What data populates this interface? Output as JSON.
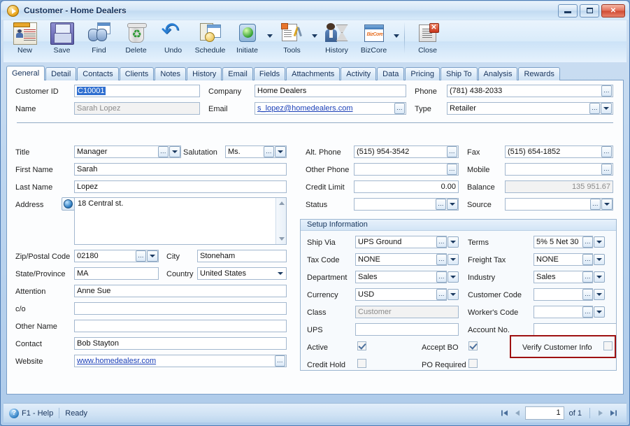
{
  "window": {
    "title": "Customer - Home Dealers",
    "app_icon": "play-circle-icon",
    "buttons": {
      "minimize": "minimize-icon",
      "maximize": "maximize-icon",
      "close": "close-icon"
    }
  },
  "toolbar": {
    "items": [
      {
        "label": "New",
        "icon": "new-record-icon",
        "dropdown": false
      },
      {
        "label": "Save",
        "icon": "save-floppy-icon",
        "dropdown": false
      },
      {
        "label": "Find",
        "icon": "find-binoculars-icon",
        "dropdown": false
      },
      {
        "label": "Delete",
        "icon": "delete-recycle-bin-icon",
        "dropdown": false
      },
      {
        "label": "Undo",
        "icon": "undo-arrow-icon",
        "dropdown": false
      },
      {
        "label": "Schedule",
        "icon": "schedule-clock-icon",
        "dropdown": false
      },
      {
        "label": "Initiate",
        "icon": "initiate-traffic-light-icon",
        "dropdown": true
      },
      {
        "label": "Tools",
        "icon": "tools-wrench-icon",
        "dropdown": true
      },
      {
        "label": "History",
        "icon": "history-person-hourglass-icon",
        "dropdown": false
      },
      {
        "label": "BizCore",
        "icon": "bizcore-window-icon",
        "dropdown": true
      },
      {
        "label": "Close",
        "icon": "close-document-icon",
        "dropdown": false
      }
    ],
    "bizcore_badge": "BizCore"
  },
  "tabs": {
    "active": "General",
    "items": [
      "General",
      "Detail",
      "Contacts",
      "Clients",
      "Notes",
      "History",
      "Email",
      "Fields",
      "Attachments",
      "Activity",
      "Data",
      "Pricing",
      "Ship To",
      "Analysis",
      "Rewards"
    ]
  },
  "header_fields": {
    "customer_id": {
      "label": "Customer ID",
      "value": "C10001",
      "selected": true
    },
    "name": {
      "label": "Name",
      "value": "Sarah Lopez",
      "readonly": true
    },
    "company": {
      "label": "Company",
      "value": "Home Dealers"
    },
    "email": {
      "label": "Email",
      "value": "s_lopez@homedealers.com",
      "link": true
    },
    "phone": {
      "label": "Phone",
      "value": "(781) 438-2033"
    },
    "type": {
      "label": "Type",
      "value": "Retailer"
    }
  },
  "left_column": {
    "title": {
      "label": "Title",
      "value": "Manager"
    },
    "salutation": {
      "label": "Salutation",
      "value": "Ms."
    },
    "first_name": {
      "label": "First Name",
      "value": "Sarah"
    },
    "last_name": {
      "label": "Last Name",
      "value": "Lopez"
    },
    "address": {
      "label": "Address",
      "value": "18 Central st.",
      "globe_icon": "globe-icon"
    },
    "zip": {
      "label": "Zip/Postal Code",
      "value": "02180"
    },
    "city": {
      "label": "City",
      "value": "Stoneham"
    },
    "state": {
      "label": "State/Province",
      "value": "MA"
    },
    "country": {
      "label": "Country",
      "value": "United States"
    },
    "attention": {
      "label": "Attention",
      "value": "Anne Sue"
    },
    "co": {
      "label": "c/o",
      "value": ""
    },
    "other_name": {
      "label": "Other Name",
      "value": ""
    },
    "contact": {
      "label": "Contact",
      "value": "Bob Stayton"
    },
    "website": {
      "label": "Website",
      "value": "www.homedealesr.com",
      "link": true
    }
  },
  "right_column": {
    "alt_phone": {
      "label": "Alt. Phone",
      "value": "(515) 954-3542"
    },
    "fax": {
      "label": "Fax",
      "value": "(515) 654-1852"
    },
    "other_phone": {
      "label": "Other Phone",
      "value": ""
    },
    "mobile": {
      "label": "Mobile",
      "value": ""
    },
    "credit_limit": {
      "label": "Credit Limit",
      "value": "0.00"
    },
    "balance": {
      "label": "Balance",
      "value": "135 951.67",
      "readonly": true
    },
    "status": {
      "label": "Status",
      "value": ""
    },
    "source": {
      "label": "Source",
      "value": ""
    }
  },
  "setup_information": {
    "title": "Setup Information",
    "ship_via": {
      "label": "Ship Via",
      "value": "UPS Ground"
    },
    "terms": {
      "label": "Terms",
      "value": "5% 5 Net 30"
    },
    "tax_code": {
      "label": "Tax Code",
      "value": "NONE"
    },
    "freight_tax": {
      "label": "Freight Tax",
      "value": "NONE"
    },
    "department": {
      "label": "Department",
      "value": "Sales"
    },
    "industry": {
      "label": "Industry",
      "value": "Sales"
    },
    "currency": {
      "label": "Currency",
      "value": "USD"
    },
    "customer_code": {
      "label": "Customer Code",
      "value": ""
    },
    "class": {
      "label": "Class",
      "value": "Customer",
      "readonly": true
    },
    "workers_code": {
      "label": "Worker's Code",
      "value": ""
    },
    "ups": {
      "label": "UPS",
      "value": ""
    },
    "account_no": {
      "label": "Account No.",
      "value": ""
    },
    "checkboxes": {
      "active": {
        "label": "Active",
        "checked": true
      },
      "accept_bo": {
        "label": "Accept BO",
        "checked": true
      },
      "verify_info": {
        "label": "Verify Customer Info",
        "checked": false,
        "highlighted": true
      },
      "credit_hold": {
        "label": "Credit Hold",
        "checked": false
      },
      "po_required": {
        "label": "PO Required",
        "checked": false
      }
    }
  },
  "status_bar": {
    "help_icon": "help-question-icon",
    "help_label": "F1 - Help",
    "status": "Ready",
    "nav": {
      "first": "nav-first-icon",
      "prev": "nav-prev-icon",
      "page": "1",
      "of_label": "of 1",
      "next": "nav-next-icon",
      "last": "nav-last-icon"
    }
  },
  "colors": {
    "highlight_box": "#9e1111",
    "selection": "#2f6fd0",
    "link": "#1b40b8",
    "accent": "#17335c"
  }
}
